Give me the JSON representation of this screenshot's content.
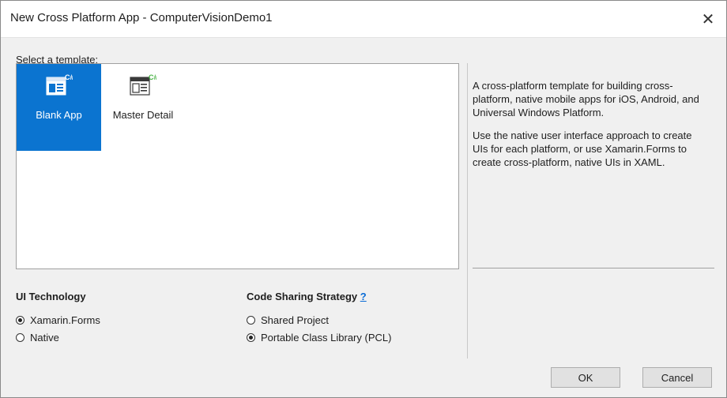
{
  "window": {
    "title": "New Cross Platform App - ComputerVisionDemo1",
    "close_glyph": "✕"
  },
  "templates": {
    "label": "Select a template:",
    "items": [
      {
        "label": "Blank App",
        "icon": "csharp-app-template-icon",
        "selected": true
      },
      {
        "label": "Master Detail",
        "icon": "csharp-master-detail-template-icon",
        "selected": false
      }
    ]
  },
  "description": {
    "p1": "A cross-platform template for building cross-platform, native mobile apps for iOS, Android, and Universal Windows Platform.",
    "p2": "Use the native user interface approach to create UIs for each platform, or use Xamarin.Forms to create cross-platform, native UIs in XAML."
  },
  "ui_technology": {
    "title": "UI Technology",
    "options": [
      {
        "label": "Xamarin.Forms",
        "checked": true
      },
      {
        "label": "Native",
        "checked": false
      }
    ]
  },
  "code_sharing": {
    "title": "Code Sharing Strategy",
    "help": "?",
    "options": [
      {
        "label": "Shared Project",
        "checked": false
      },
      {
        "label": "Portable Class Library (PCL)",
        "checked": true
      }
    ]
  },
  "buttons": {
    "ok": "OK",
    "cancel": "Cancel"
  },
  "colors": {
    "selection": "#0b74d0",
    "icon_green": "#4bb348",
    "link": "#0a6cd6"
  }
}
